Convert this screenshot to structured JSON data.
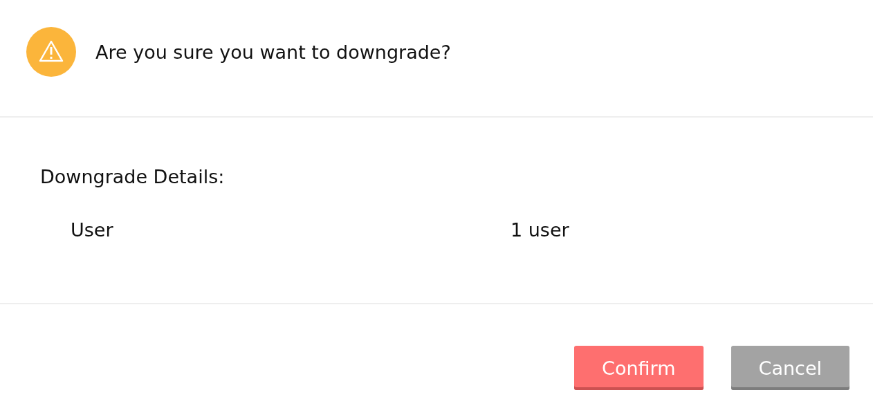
{
  "dialog": {
    "title": "Are you sure you want to downgrade?"
  },
  "details": {
    "heading": "Downgrade Details:",
    "rows": [
      {
        "label": "User",
        "value": "1 user"
      }
    ]
  },
  "buttons": [
    {
      "label": "Confirm",
      "kind": "danger"
    },
    {
      "label": "Cancel",
      "kind": "neutral"
    }
  ]
}
